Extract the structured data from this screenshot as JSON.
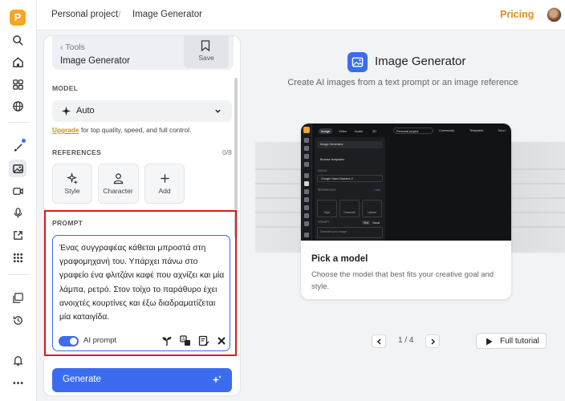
{
  "rail": {
    "logo_letter": "P",
    "icons": [
      "search-icon",
      "home-icon",
      "apps-icon",
      "globe-icon",
      "brush-icon",
      "image-icon",
      "video-icon",
      "mic-icon",
      "share-icon",
      "grid-icon",
      "gallery-icon",
      "history-icon",
      "bell-icon",
      "more-icon"
    ],
    "active": "image-icon"
  },
  "header": {
    "project": "Personal project",
    "separator": "/",
    "page": "Image Generator",
    "pricing": "Pricing"
  },
  "panel": {
    "tools_label": "Tools",
    "tools_title": "Image Generator",
    "save_label": "Save",
    "model_section": "MODEL",
    "model_value": "Auto",
    "upgrade_link": "Upgrade",
    "upgrade_text": "for top quality, speed, and full control.",
    "references_section": "REFERENCES",
    "references_count": "0/8",
    "reference_tiles": [
      {
        "label": "Style",
        "icon": "style-icon"
      },
      {
        "label": "Character",
        "icon": "character-icon"
      },
      {
        "label": "Add",
        "icon": "plus-icon"
      }
    ],
    "prompt_section": "PROMPT",
    "prompt_text": "Ένας συγγραφέας κάθεται μπροστά στη γραφομηχανή του. Υπάρχει πάνω στο γραφείο ένα φλιτζάνι καφέ που αχνίζει και μία λάμπα, ρετρό. Στον τοίχο το παράθυρο έχει ανοιχτές κουρτίνες και έξω διαδραματίζεται μία καταιγίδα.",
    "ai_prompt_label": "AI prompt",
    "ai_prompt_enabled": true,
    "generate_label": "Generate"
  },
  "main": {
    "title": "Image Generator",
    "subtitle": "Create AI images from a text prompt or an image reference",
    "card_title": "Pick a model",
    "card_desc": "Choose the model that best fits your creative goal and style.",
    "pagination": "1 / 4",
    "tutorial_label": "Full tutorial",
    "mockup": {
      "tabs": [
        "Image",
        "Video",
        "Audio",
        "3D"
      ],
      "project": "Personal project",
      "top_links": [
        "Community",
        "Templates",
        "Tutori"
      ],
      "panel_title": "Image Generator",
      "browse": "Browse templates",
      "model_label": "MODEL",
      "model": "Google Nano Banana 2",
      "references_label": "REFERENCES",
      "add_link": "+ Add",
      "tiles": [
        "Style",
        "Character",
        "Upload"
      ],
      "prompt_label": "PROMPT",
      "chips": [
        "Text",
        "Visual"
      ],
      "placeholder": "Describe your image"
    }
  },
  "colors": {
    "accent": "#3b6cf0",
    "pricing": "#e98a1f",
    "highlight": "#e01b1b"
  }
}
